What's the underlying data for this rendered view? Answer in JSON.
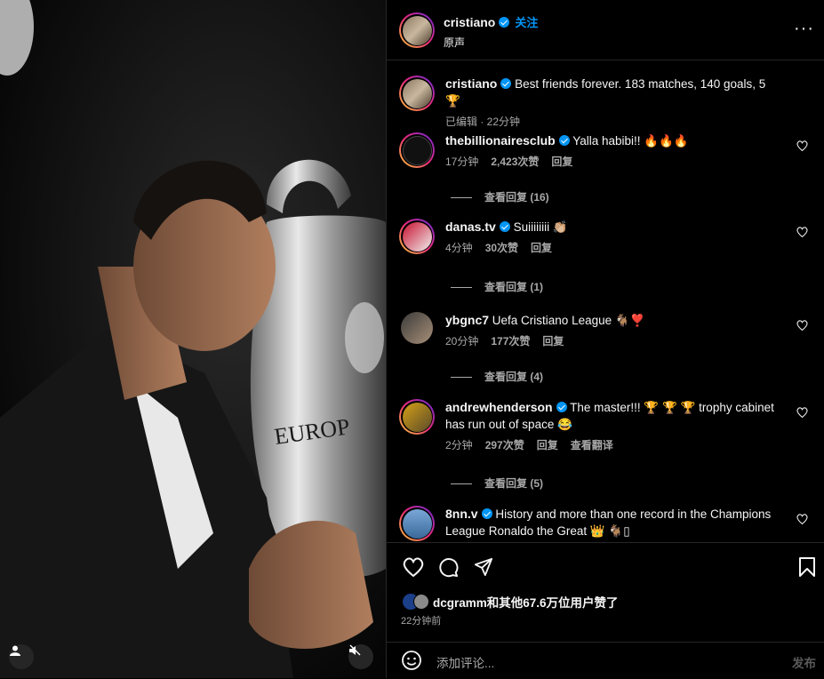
{
  "header": {
    "username": "cristiano",
    "follow_label": "关注",
    "audio_label": "原声",
    "more_label": "···"
  },
  "caption": {
    "username": "cristiano",
    "text": "Best friends forever. 183 matches, 140 goals, 5 🏆",
    "meta": "已编辑 · 22分钟"
  },
  "comments": [
    {
      "username": "thebillionairesclub",
      "verified": true,
      "text": "Yalla habibi!! 🔥🔥🔥",
      "time": "17分钟",
      "likes": "2,423次赞",
      "reply": "回复",
      "view_replies": "查看回复 (16)"
    },
    {
      "username": "danas.tv",
      "verified": true,
      "text": "Suiiiiiiii 👏🏼",
      "time": "4分钟",
      "likes": "30次赞",
      "reply": "回复",
      "view_replies": "查看回复 (1)"
    },
    {
      "username": "ybgnc7",
      "verified": false,
      "text": "Uefa Cristiano League 🐐❣️",
      "time": "20分钟",
      "likes": "177次赞",
      "reply": "回复",
      "view_replies": "查看回复 (4)"
    },
    {
      "username": "andrewhenderson",
      "verified": true,
      "text": "The master!!! 🏆 🏆 🏆 trophy cabinet has run out of space 😂",
      "time": "2分钟",
      "likes": "297次赞",
      "reply": "回复",
      "translate": "查看翻译",
      "view_replies": "查看回复 (5)"
    },
    {
      "username": "8nn.v",
      "verified": true,
      "text": "History and more than one record in the Champions League Ronaldo the Great 👑 🐐▯"
    }
  ],
  "footer": {
    "liked_by": "dcgramm和其他67.6万位用户赞了",
    "time": "22分钟前",
    "comment_placeholder": "添加评论...",
    "post_label": "发布"
  },
  "colors": {
    "accent": "#0095f6",
    "secondary_text": "#a8a8a8",
    "border": "#262626"
  }
}
